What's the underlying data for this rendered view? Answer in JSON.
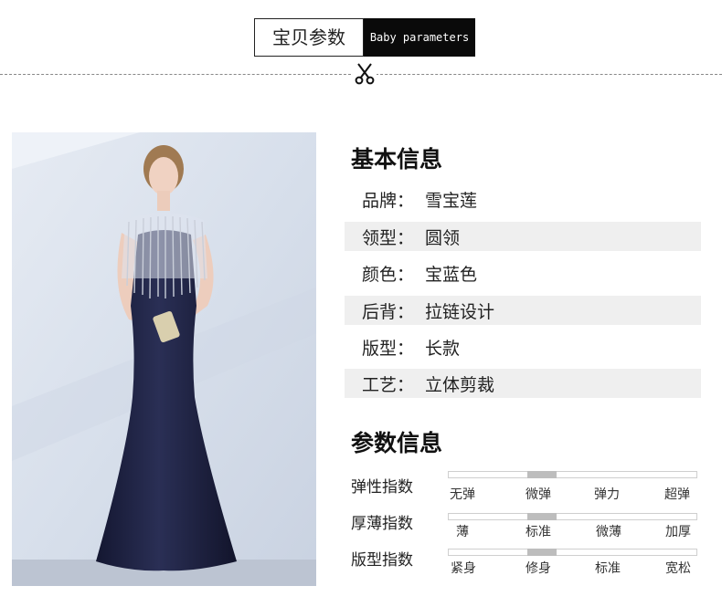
{
  "header": {
    "title_cn": "宝贝参数",
    "title_en": "Baby parameters"
  },
  "icons": {
    "divider": "scissors-icon"
  },
  "basic_info": {
    "title": "基本信息",
    "rows": [
      {
        "key": "品牌：",
        "value": "雪宝莲"
      },
      {
        "key": "领型：",
        "value": "圆领"
      },
      {
        "key": "颜色：",
        "value": "宝蓝色"
      },
      {
        "key": "后背：",
        "value": "拉链设计"
      },
      {
        "key": "版型：",
        "value": "长款"
      },
      {
        "key": "工艺：",
        "value": "立体剪裁"
      }
    ]
  },
  "params": {
    "title": "参数信息",
    "items": [
      {
        "label": "弹性指数",
        "options": [
          "无弹",
          "微弹",
          "弹力",
          "超弹"
        ],
        "selected_index": 1
      },
      {
        "label": "厚薄指数",
        "options": [
          "薄",
          "标准",
          "微薄",
          "加厚"
        ],
        "selected_index": 1
      },
      {
        "label": "版型指数",
        "options": [
          "紧身",
          "修身",
          "标准",
          "宽松"
        ],
        "selected_index": 1
      }
    ]
  },
  "colors": {
    "header_dark": "#0a0a0a",
    "row_shade": "#efefef",
    "scale_highlight": "#bdbdbd",
    "dress_navy": "#1c1f3a",
    "backdrop": "#d9e1ee"
  }
}
